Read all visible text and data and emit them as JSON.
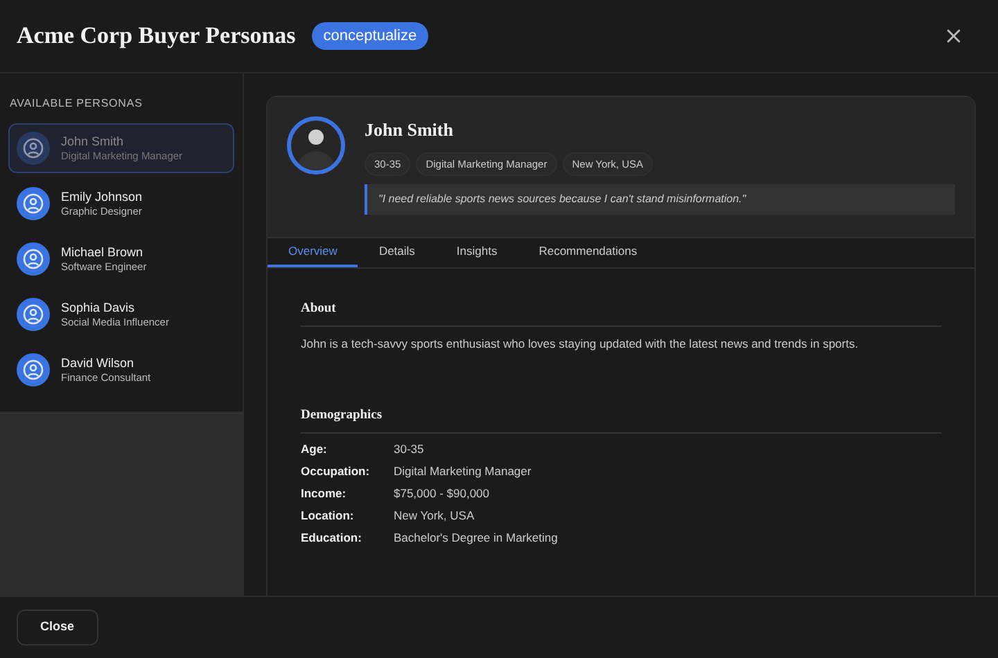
{
  "window": {
    "title": "Acme Corp Buyer Personas",
    "badge": "conceptualize"
  },
  "sidebar": {
    "heading": "AVAILABLE PERSONAS",
    "items": [
      {
        "name": "John Smith",
        "role": "Digital Marketing Manager",
        "selected": true
      },
      {
        "name": "Emily Johnson",
        "role": "Graphic Designer",
        "selected": false
      },
      {
        "name": "Michael Brown",
        "role": "Software Engineer",
        "selected": false
      },
      {
        "name": "Sophia Davis",
        "role": "Social Media Influencer",
        "selected": false
      },
      {
        "name": "David Wilson",
        "role": "Finance Consultant",
        "selected": false
      }
    ]
  },
  "profile": {
    "name": "John Smith",
    "tags": [
      "30-35",
      "Digital Marketing Manager",
      "New York, USA"
    ],
    "quote": "\"I need reliable sports news sources because I can't stand misinformation.\""
  },
  "tabs": [
    {
      "label": "Overview",
      "selected": true
    },
    {
      "label": "Details",
      "selected": false
    },
    {
      "label": "Insights",
      "selected": false
    },
    {
      "label": "Recommendations",
      "selected": false
    }
  ],
  "about": {
    "heading": "About",
    "text": "John is a tech-savvy sports enthusiast who loves staying updated with the latest news and trends in sports."
  },
  "demographics": {
    "heading": "Demographics",
    "rows": [
      {
        "label": "Age:",
        "value": "30-35"
      },
      {
        "label": "Occupation:",
        "value": "Digital Marketing Manager"
      },
      {
        "label": "Income:",
        "value": "$75,000 - $90,000"
      },
      {
        "label": "Location:",
        "value": "New York, USA"
      },
      {
        "label": "Education:",
        "value": "Bachelor's Degree in Marketing"
      }
    ]
  },
  "footer": {
    "button": "Close"
  }
}
